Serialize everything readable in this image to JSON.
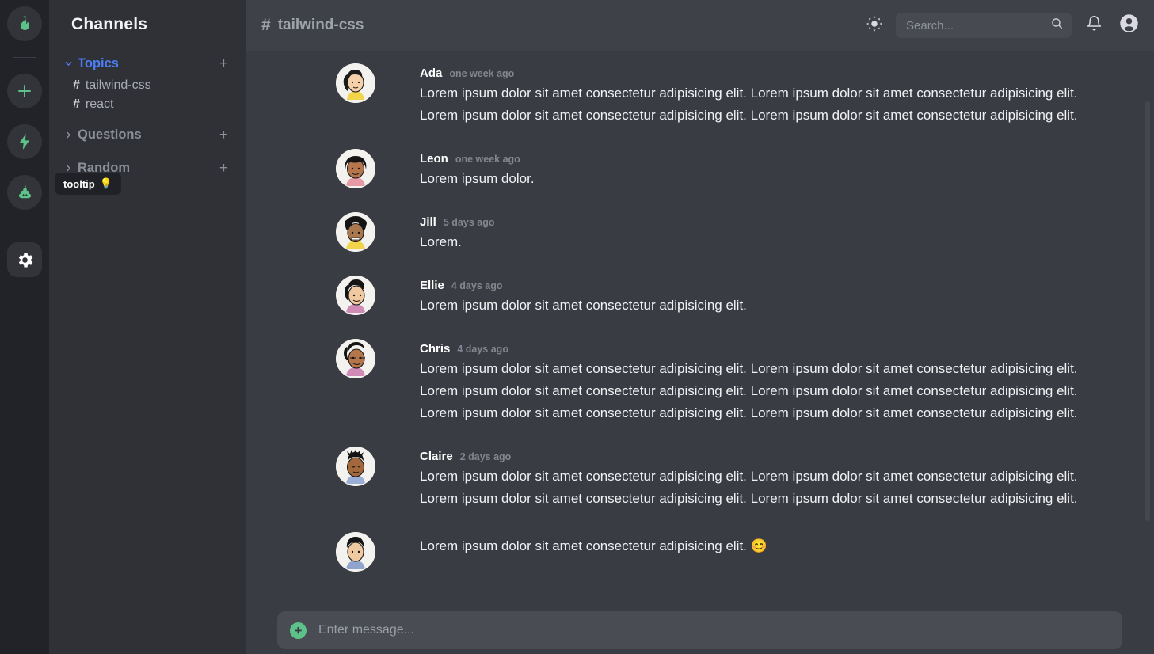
{
  "rail": {
    "items": [
      {
        "name": "flame-icon",
        "label": "Home"
      },
      {
        "name": "plus-icon",
        "label": "Add server"
      },
      {
        "name": "bolt-icon",
        "label": "Activity"
      },
      {
        "name": "poop-icon",
        "label": "Fun",
        "emoji": "💩"
      },
      {
        "name": "gear-icon",
        "label": "Settings"
      }
    ]
  },
  "sidebar": {
    "title": "Channels",
    "tooltip": {
      "text": "tooltip",
      "emoji": "💡"
    },
    "groups": [
      {
        "label": "Topics",
        "expanded": true,
        "add_label": "+",
        "channels": [
          {
            "hash": "#",
            "name": "tailwind-css"
          },
          {
            "hash": "#",
            "name": "react"
          }
        ]
      },
      {
        "label": "Questions",
        "expanded": false,
        "add_label": "+",
        "channels": []
      },
      {
        "label": "Random",
        "expanded": false,
        "add_label": "+",
        "channels": []
      }
    ]
  },
  "topbar": {
    "hash": "#",
    "channel": "tailwind-css",
    "search_placeholder": "Search...",
    "search_value": ""
  },
  "composer": {
    "placeholder": "Enter message...",
    "value": "",
    "add_label": "+"
  },
  "messages": [
    {
      "author": "Ada",
      "time": "one week ago",
      "text": "Lorem ipsum dolor sit amet consectetur adipisicing elit. Lorem ipsum dolor sit amet consectetur adipisicing elit. Lorem ipsum dolor sit amet consectetur adipisicing elit. Lorem ipsum dolor sit amet consectetur adipisicing elit."
    },
    {
      "author": "Leon",
      "time": "one week ago",
      "text": "Lorem ipsum dolor."
    },
    {
      "author": "Jill",
      "time": "5 days ago",
      "text": "Lorem."
    },
    {
      "author": "Ellie",
      "time": "4 days ago",
      "text": "Lorem ipsum dolor sit amet consectetur adipisicing elit."
    },
    {
      "author": "Chris",
      "time": "4 days ago",
      "text": "Lorem ipsum dolor sit amet consectetur adipisicing elit. Lorem ipsum dolor sit amet consectetur adipisicing elit. Lorem ipsum dolor sit amet consectetur adipisicing elit. Lorem ipsum dolor sit amet consectetur adipisicing elit. Lorem ipsum dolor sit amet consectetur adipisicing elit. Lorem ipsum dolor sit amet consectetur adipisicing elit."
    },
    {
      "author": "Claire",
      "time": "2 days ago",
      "text": "Lorem ipsum dolor sit amet consectetur adipisicing elit. Lorem ipsum dolor sit amet consectetur adipisicing elit. Lorem ipsum dolor sit amet consectetur adipisicing elit. Lorem ipsum dolor sit amet consectetur adipisicing elit."
    },
    {
      "author": "",
      "time": "",
      "text": "Lorem ipsum dolor sit amet consectetur adipisicing elit. 😊"
    }
  ],
  "colors": {
    "rail_bg": "#212328",
    "sidebar_bg": "#2f3136",
    "chat_bg": "#3a3c44",
    "topbar_bg": "#3f4148",
    "accent_green": "#5dc28a",
    "accent_blue": "#4c7df0",
    "muted_text": "#8b8f98"
  }
}
